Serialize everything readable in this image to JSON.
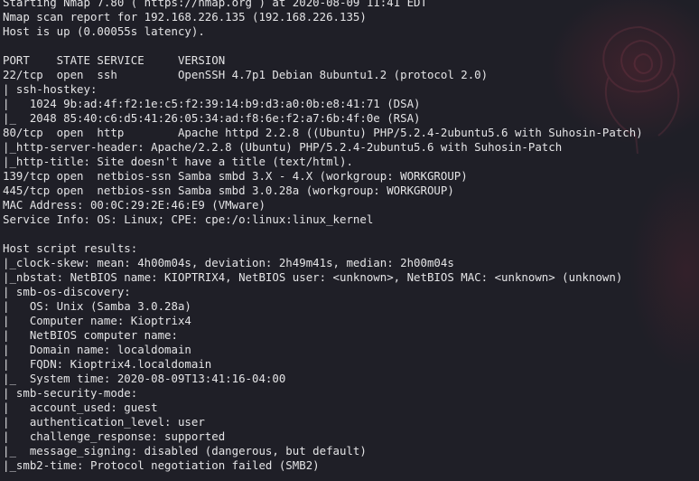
{
  "terminal": {
    "lines": [
      "Starting Nmap 7.80 ( https://nmap.org ) at 2020-08-09 11:41 EDT",
      "Nmap scan report for 192.168.226.135 (192.168.226.135)",
      "Host is up (0.00055s latency).",
      "",
      "PORT    STATE SERVICE     VERSION",
      "22/tcp  open  ssh         OpenSSH 4.7p1 Debian 8ubuntu1.2 (protocol 2.0)",
      "| ssh-hostkey:",
      "|   1024 9b:ad:4f:f2:1e:c5:f2:39:14:b9:d3:a0:0b:e8:41:71 (DSA)",
      "|_  2048 85:40:c6:d5:41:26:05:34:ad:f8:6e:f2:a7:6b:4f:0e (RSA)",
      "80/tcp  open  http        Apache httpd 2.2.8 ((Ubuntu) PHP/5.2.4-2ubuntu5.6 with Suhosin-Patch)",
      "|_http-server-header: Apache/2.2.8 (Ubuntu) PHP/5.2.4-2ubuntu5.6 with Suhosin-Patch",
      "|_http-title: Site doesn't have a title (text/html).",
      "139/tcp open  netbios-ssn Samba smbd 3.X - 4.X (workgroup: WORKGROUP)",
      "445/tcp open  netbios-ssn Samba smbd 3.0.28a (workgroup: WORKGROUP)",
      "MAC Address: 00:0C:29:2E:46:E9 (VMware)",
      "Service Info: OS: Linux; CPE: cpe:/o:linux:linux_kernel",
      "",
      "Host script results:",
      "|_clock-skew: mean: 4h00m04s, deviation: 2h49m41s, median: 2h00m04s",
      "|_nbstat: NetBIOS name: KIOPTRIX4, NetBIOS user: <unknown>, NetBIOS MAC: <unknown> (unknown)",
      "| smb-os-discovery:",
      "|   OS: Unix (Samba 3.0.28a)",
      "|   Computer name: Kioptrix4",
      "|   NetBIOS computer name:",
      "|   Domain name: localdomain",
      "|   FQDN: Kioptrix4.localdomain",
      "|_  System time: 2020-08-09T13:41:16-04:00",
      "| smb-security-mode:",
      "|   account_used: guest",
      "|   authentication_level: user",
      "|   challenge_response: supported",
      "|_  message_signing: disabled (dangerous, but default)",
      "|_smb2-time: Protocol negotiation failed (SMB2)"
    ]
  },
  "colors": {
    "background": "#1f1f27",
    "text": "#e4e4e6",
    "accent": "#78283a"
  }
}
